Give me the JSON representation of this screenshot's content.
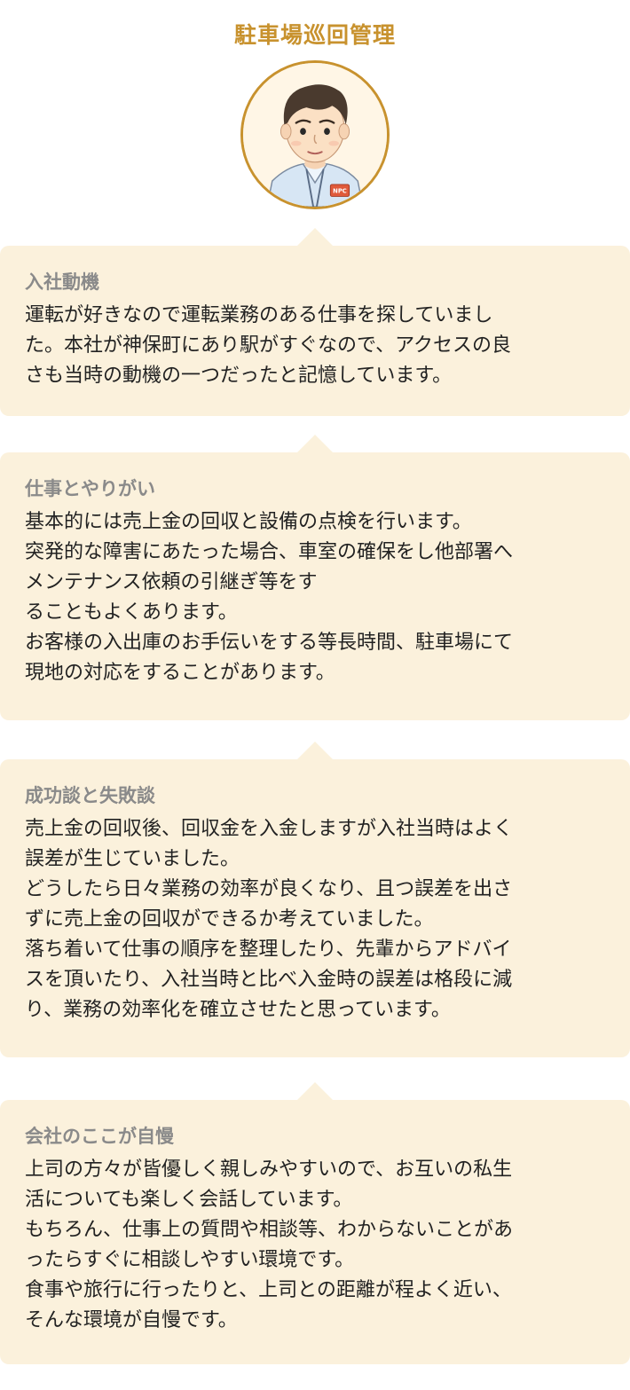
{
  "header": {
    "title": "駐車場巡回管理"
  },
  "avatar": {
    "badge_text": "NPC"
  },
  "sections": [
    {
      "heading": "入社動機",
      "body": "運転が好きなので運転業務のある仕事を探していまし\nた。本社が神保町にあり駅がすぐなので、アクセスの良\nさも当時の動機の一つだったと記憶しています。"
    },
    {
      "heading": "仕事とやりがい",
      "body": "基本的には売上金の回収と設備の点検を行います。\n突発的な障害にあたった場合、車室の確保をし他部署へ\nメンテナンス依頼の引継ぎ等をす\nることもよくあります。\nお客様の入出庫のお手伝いをする等長時間、駐車場にて\n現地の対応をすることがあります。"
    },
    {
      "heading": "成功談と失敗談",
      "body": "売上金の回収後、回収金を入金しますが入社当時はよく\n誤差が生じていました。\nどうしたら日々業務の効率が良くなり、且つ誤差を出さ\nずに売上金の回収ができるか考えていました。\n落ち着いて仕事の順序を整理したり、先輩からアドバイ\nスを頂いたり、入社当時と比べ入金時の誤差は格段に減\nり、業務の効率化を確立させたと思っています。"
    },
    {
      "heading": "会社のここが自慢",
      "body": "上司の方々が皆優しく親しみやすいので、お互いの私生\n活についても楽しく会話しています。\nもちろん、仕事上の質問や相談等、わからないことがあ\nったらすぐに相談しやすい環境です。\n食事や旅行に行ったりと、上司との距離が程よく近い、\nそんな環境が自慢です。"
    }
  ],
  "colors": {
    "accent": "#c8922e",
    "card_background": "#fbf1dc",
    "heading_gray": "#8a8a8a",
    "body_text": "#222222"
  }
}
